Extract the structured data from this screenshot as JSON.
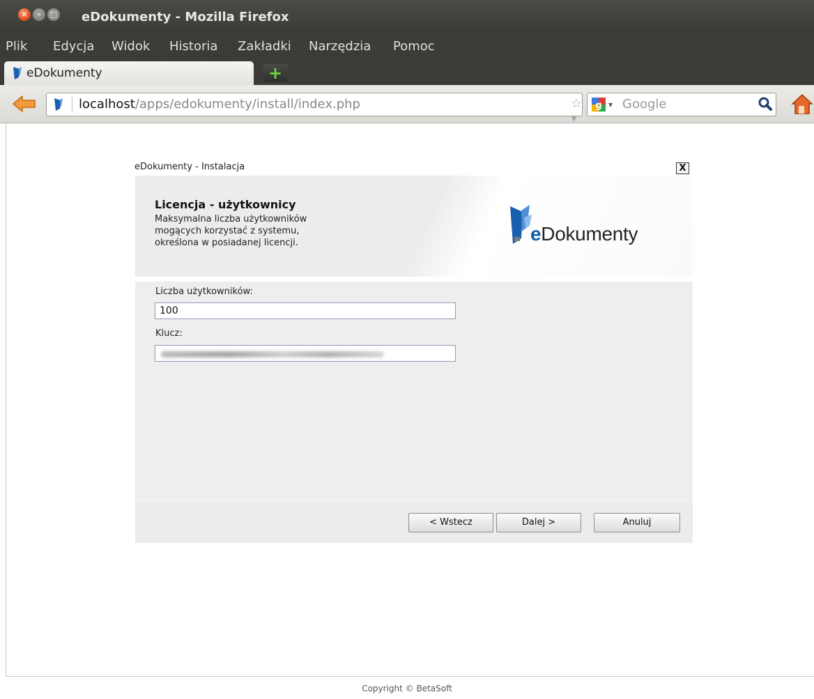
{
  "window": {
    "title": "eDokumenty - Mozilla Firefox"
  },
  "menu": {
    "items": [
      {
        "label": "Plik"
      },
      {
        "label": "Edycja"
      },
      {
        "label": "Widok"
      },
      {
        "label": "Historia"
      },
      {
        "label": "Zakładki"
      },
      {
        "label": "Narzędzia"
      },
      {
        "label": "Pomoc"
      }
    ]
  },
  "tab": {
    "title": "eDokumenty"
  },
  "urlbar": {
    "host": "localhost",
    "path": "/apps/edokumenty/install/index.php"
  },
  "search": {
    "placeholder": "Google"
  },
  "dialog": {
    "title": "eDokumenty - Instalacja",
    "close_label": "X",
    "header": {
      "title": "Licencja - użytkownicy",
      "description": "Maksymalna liczba użytkowników\nmogących korzystać z systemu,\nokreślona w posiadanej licencji.",
      "logo_e": "e",
      "logo_rest": "Dokumenty"
    },
    "fields": {
      "users_label": "Liczba użytkowników:",
      "users_value": "100",
      "key_label": "Klucz:"
    },
    "buttons": {
      "back": "< Wstecz",
      "next": "Dalej >",
      "cancel": "Anuluj"
    }
  },
  "footer": {
    "copyright": "Copyright © BetaSoft"
  },
  "colors": {
    "accent": "#0f5ba8",
    "titlebar": "#3c3b37",
    "close_button": "#e2501f"
  }
}
